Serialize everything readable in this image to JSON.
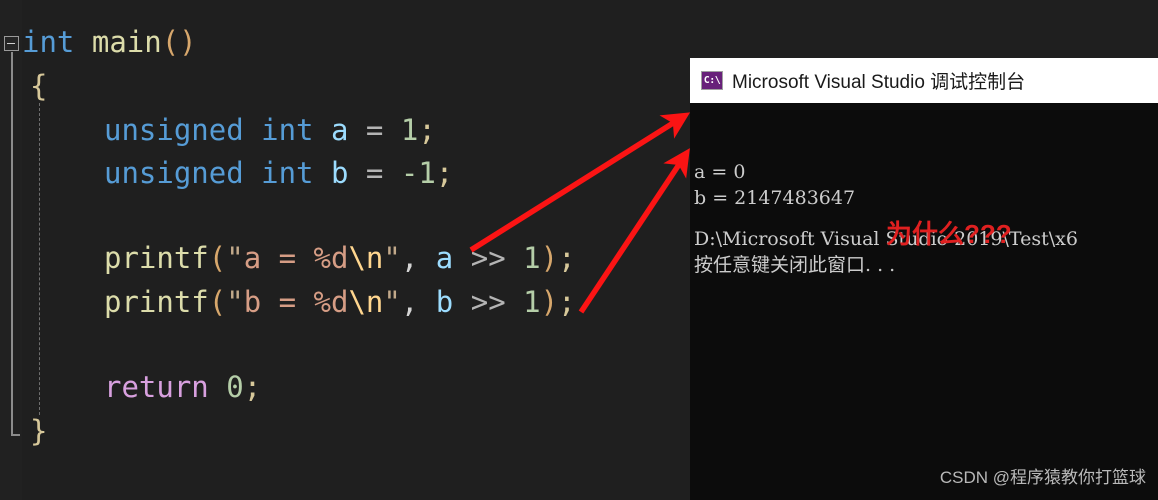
{
  "editor": {
    "language": "c",
    "background_color": "#1f1f1f",
    "collapse_marker": "[-]",
    "lines": [
      {
        "id": "main",
        "text": "int main()"
      },
      {
        "id": "brace1",
        "text": "{"
      },
      {
        "id": "decl1",
        "text": "unsigned int a = 1;"
      },
      {
        "id": "decl2",
        "text": "unsigned int b = -1;"
      },
      {
        "id": "print1",
        "text": "printf(\"a = %d\\n\", a >> 1);"
      },
      {
        "id": "print2",
        "text": "printf(\"b = %d\\n\", b >> 1);"
      },
      {
        "id": "ret",
        "text": "return 0;"
      },
      {
        "id": "brace2",
        "text": "}"
      }
    ],
    "tokens": {
      "kw_int": "int",
      "fn_main": "main",
      "paren_open": "(",
      "paren_close": ")",
      "brace_open": "{",
      "brace_close": "}",
      "kw_unsigned_int": "unsigned int",
      "var_a": "a",
      "var_b": "b",
      "assign": "=",
      "num_one": "1",
      "num_neg_one": "-1",
      "semicolon": ";",
      "fn_printf": "printf",
      "quote": "\"",
      "str_a_fmt": "a = %d",
      "str_b_fmt": "b = %d",
      "escape_newline": "\\n",
      "comma": ",",
      "shift_op": ">>",
      "kw_return": "return",
      "num_zero": "0"
    },
    "colors": {
      "keyword": "#569cd6",
      "function": "#dcdcaa",
      "variable": "#9cdcfe",
      "number": "#b5cea8",
      "string": "#d69d85",
      "escape": "#ffd68f",
      "control": "#d8a0df",
      "operator": "#b4b4b4",
      "paren": "#d7a76c"
    }
  },
  "console": {
    "title": "Microsoft Visual Studio 调试控制台",
    "icon_label": "C:\\",
    "titlebar_color": "#ffffff",
    "background_color": "#0c0c0c",
    "output": [
      "a = 0",
      "b = 2147483647",
      "D:\\Microsoft Visual Studio 2019\\Test\\x6",
      "按任意键关闭此窗口. . ."
    ],
    "annotation": {
      "text": "为什么???",
      "color": "#e02020"
    },
    "watermark": "CSDN @程序猿教你打篮球"
  },
  "arrows": {
    "color": "#fb1414",
    "count": 2,
    "items": [
      {
        "name": "arrow-a-to-output",
        "from": "a >> 1",
        "to": "a = 0"
      },
      {
        "name": "arrow-b-to-output",
        "from": "b >> 1",
        "to": "b = 2147483647"
      }
    ]
  }
}
